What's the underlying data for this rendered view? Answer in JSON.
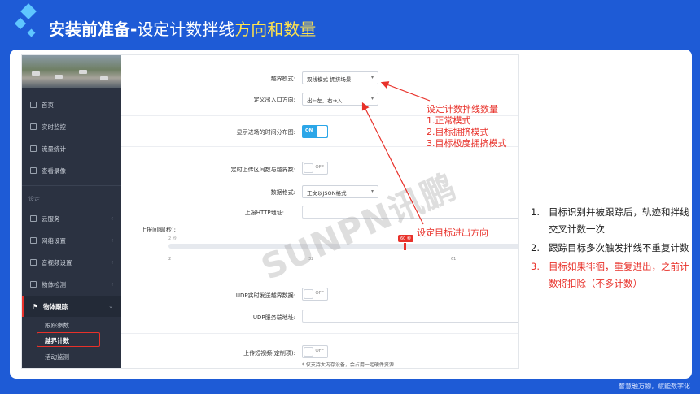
{
  "slide": {
    "title_main": "安装前准备-",
    "title_sub_a": "设定计数拌线",
    "title_sub_b": "方向和数量",
    "footer": "智慧融万物，赋能数字化"
  },
  "sidebar": {
    "items": [
      {
        "label": "首页"
      },
      {
        "label": "实时监控"
      },
      {
        "label": "流量统计"
      },
      {
        "label": "查看录像"
      }
    ],
    "section_label": "设定",
    "settings_items": [
      {
        "label": "云服务"
      },
      {
        "label": "网络设置"
      },
      {
        "label": "音视频设置"
      },
      {
        "label": "物体检测"
      }
    ],
    "active_item": {
      "label": "物体跟踪"
    },
    "sub_items": [
      {
        "label": "跟踪参数"
      },
      {
        "label": "越界计数"
      },
      {
        "label": "活动监测"
      }
    ]
  },
  "form": {
    "mode_label": "越界模式:",
    "mode_value": "双线模式-拥挤场景",
    "direction_label": "定义出入口方向:",
    "direction_value": "出←左，右→入",
    "show_time_label": "显示进场的时间分布图:",
    "show_time_state": "ON",
    "upload_label": "定时上传区间数与越界数:",
    "upload_state": "OFF",
    "format_label": "数据格式:",
    "format_value": "正文以JSON格式",
    "http_label": "上报HTTP地址:",
    "interval_label": "上报间隔(秒):",
    "slider": {
      "min_badge": "2 秒",
      "value_badge": "60 秒",
      "ticks": [
        "2",
        "32",
        "61"
      ],
      "value": 60,
      "min": 2,
      "max": 90
    },
    "udp_label": "UDP实时发送越界数据:",
    "udp_state": "OFF",
    "udp_addr_label": "UDP服务端地址:",
    "video_label": "上传短视频(定制项):",
    "video_state": "OFF",
    "video_note": "* 仅支持大内存设备，会占用一定硬件资源"
  },
  "annotations": {
    "count_title": "设定计数拌线数量",
    "count_items": [
      "1.正常模式",
      "2.目标拥挤模式",
      "3.目标极度拥挤模式"
    ],
    "direction_text": "设定目标进出方向",
    "colors": {
      "red": "#e8312a",
      "blue": "#1e5bd6",
      "accent": "#ffe34d"
    }
  },
  "watermark": "SUNPN讯鹏",
  "notes": [
    {
      "num": "1.",
      "text": "目标识别并被跟踪后，轨迹和拌线交叉计数一次"
    },
    {
      "num": "2.",
      "text": "跟踪目标多次触发拌线不重复计数"
    },
    {
      "num": "3.",
      "text": "目标如果徘徊，重复进出，之前计数将扣除（不多计数）"
    }
  ]
}
